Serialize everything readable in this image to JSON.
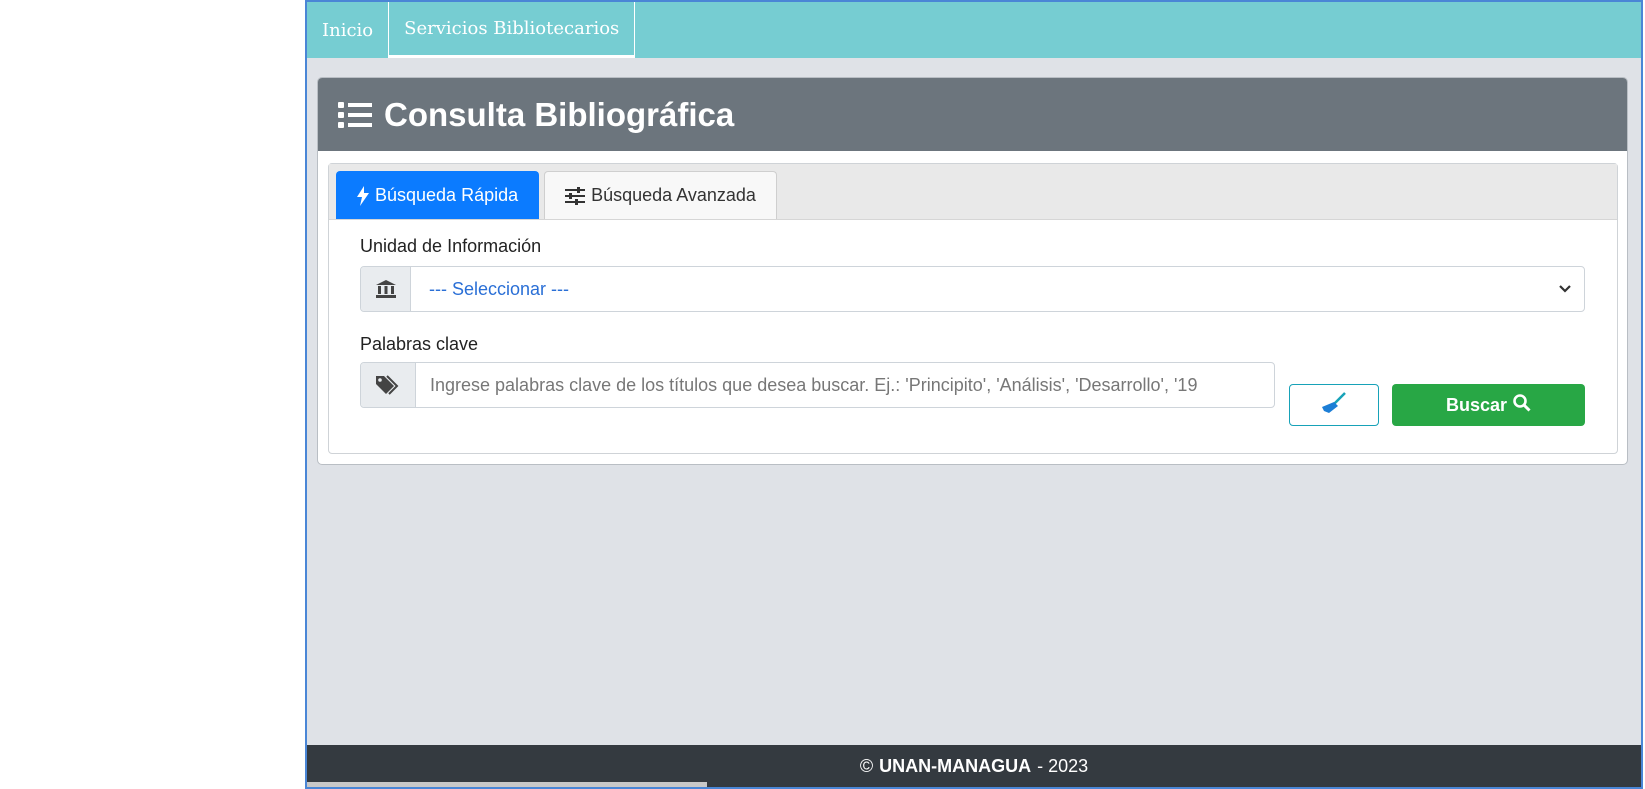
{
  "nav": {
    "items": [
      "Inicio",
      "Servicios Bibliotecarios"
    ]
  },
  "page": {
    "title": "Consulta Bibliográfica",
    "title_icon": "list-icon"
  },
  "tabs": [
    {
      "label": "Búsqueda Rápida",
      "icon": "bolt-icon",
      "active": true
    },
    {
      "label": "Búsqueda Avanzada",
      "icon": "sliders-icon",
      "active": false
    }
  ],
  "form": {
    "unidad_label": "Unidad de Información",
    "unidad_icon": "institution-icon",
    "unidad_selected": "--- Seleccionar ---",
    "keywords_label": "Palabras clave",
    "keywords_icon": "tags-icon",
    "keywords_placeholder": "Ingrese palabras clave de los títulos que desea buscar. Ej.: 'Principito', 'Análisis', 'Desarrollo', '19",
    "clear_icon": "broom-icon",
    "search_label": "Buscar",
    "search_icon": "search-icon"
  },
  "footer": {
    "copyright": "©",
    "org": "UNAN-MANAGUA",
    "year": "- 2023"
  },
  "colors": {
    "nav_bg": "#76cdd2",
    "header_bg": "#6c757d",
    "tab_active": "#0b7bff",
    "search_btn": "#28a745",
    "footer_bg": "#343a40"
  }
}
